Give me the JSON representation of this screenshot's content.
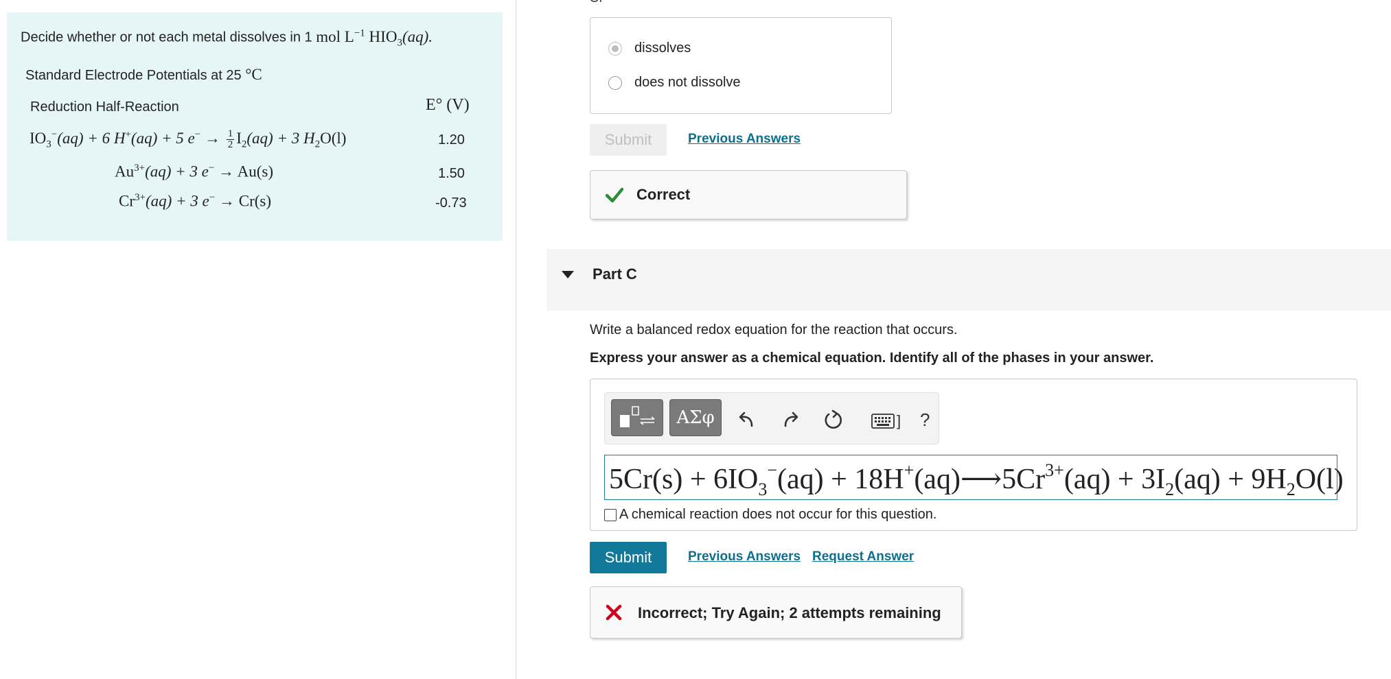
{
  "problem": {
    "intro_text": "Decide whether or not each metal dissolves in 1",
    "intro_math": "mol L",
    "intro_exp": "−1",
    "intro_acid": "HIO",
    "intro_acid_sub": "3",
    "intro_phase": "(aq).",
    "table_caption": "Standard Electrode Potentials at 25",
    "table_caption_unit": "°C",
    "col_reaction": "Reduction Half-Reaction",
    "col_potential": "E° (V)",
    "rows": [
      {
        "lhs_a": "IO",
        "lhs_a_sub": "3",
        "lhs_a_sup": "−",
        "lhs_b": "(aq) + 6 H",
        "lhs_b_sup": "+",
        "lhs_c": "(aq) + 5 e",
        "lhs_c_sup": "−",
        "arrow": " → ",
        "frac_num": "1",
        "frac_den": "2",
        "rhs_a": "I",
        "rhs_a_sub": "2",
        "rhs_b": "(aq) + 3 H",
        "rhs_b_sub": "2",
        "rhs_c": "O(l)",
        "value": "1.20"
      },
      {
        "lhs_a": "Au",
        "lhs_a_sup": "3+",
        "lhs_b": "(aq) + 3 e",
        "lhs_b_sup": "−",
        "arrow": " → ",
        "rhs_a": "Au(s)",
        "value": "1.50"
      },
      {
        "lhs_a": "Cr",
        "lhs_a_sup": "3+",
        "lhs_b": "(aq) + 3 e",
        "lhs_b_sup": "−",
        "arrow": " → ",
        "rhs_a": "Cr(s)",
        "value": "-0.73"
      }
    ]
  },
  "part_b": {
    "top_cut_text": "Cr",
    "options": [
      {
        "label": "dissolves",
        "selected": true
      },
      {
        "label": "does not dissolve",
        "selected": false
      }
    ],
    "submit_label": "Submit",
    "previous_answers_label": "Previous Answers",
    "feedback": "Correct"
  },
  "part_c": {
    "title": "Part C",
    "question": "Write a balanced redox equation for the reaction that occurs.",
    "instruction": "Express your answer as a chemical equation. Identify all of the phases in your answer.",
    "toolbar": {
      "templates_icon": "templates-icon",
      "symbols_label": "ΑΣφ",
      "undo_icon": "undo-icon",
      "redo_icon": "redo-icon",
      "reset_icon": "reset-icon",
      "keyboard_icon": "keyboard-icon",
      "keyboard_suffix": "]",
      "help_label": "?"
    },
    "equation": {
      "p1": "5Cr(s) + 6IO",
      "p1_sub": "3",
      "p1_sup": "−",
      "p2": "(aq) + 18H",
      "p2_sup": "+",
      "p3": "(aq)⟶5Cr",
      "p3_sup": "3+",
      "p4": "(aq) + 3I",
      "p4_sub": "2",
      "p5": "(aq) + 9H",
      "p5_sub": "2",
      "p6": "O(l)"
    },
    "no_reaction_label": "A chemical reaction does not occur for this question.",
    "submit_label": "Submit",
    "previous_answers_label": "Previous Answers",
    "request_answer_label": "Request Answer",
    "feedback": "Incorrect; Try Again; 2 attempts remaining"
  },
  "colors": {
    "problem_bg": "#e6f6f6",
    "link": "#0d6f8f",
    "submit_bg": "#13799a",
    "correct_check": "#2e8b3a",
    "incorrect_x": "#d0021b"
  }
}
